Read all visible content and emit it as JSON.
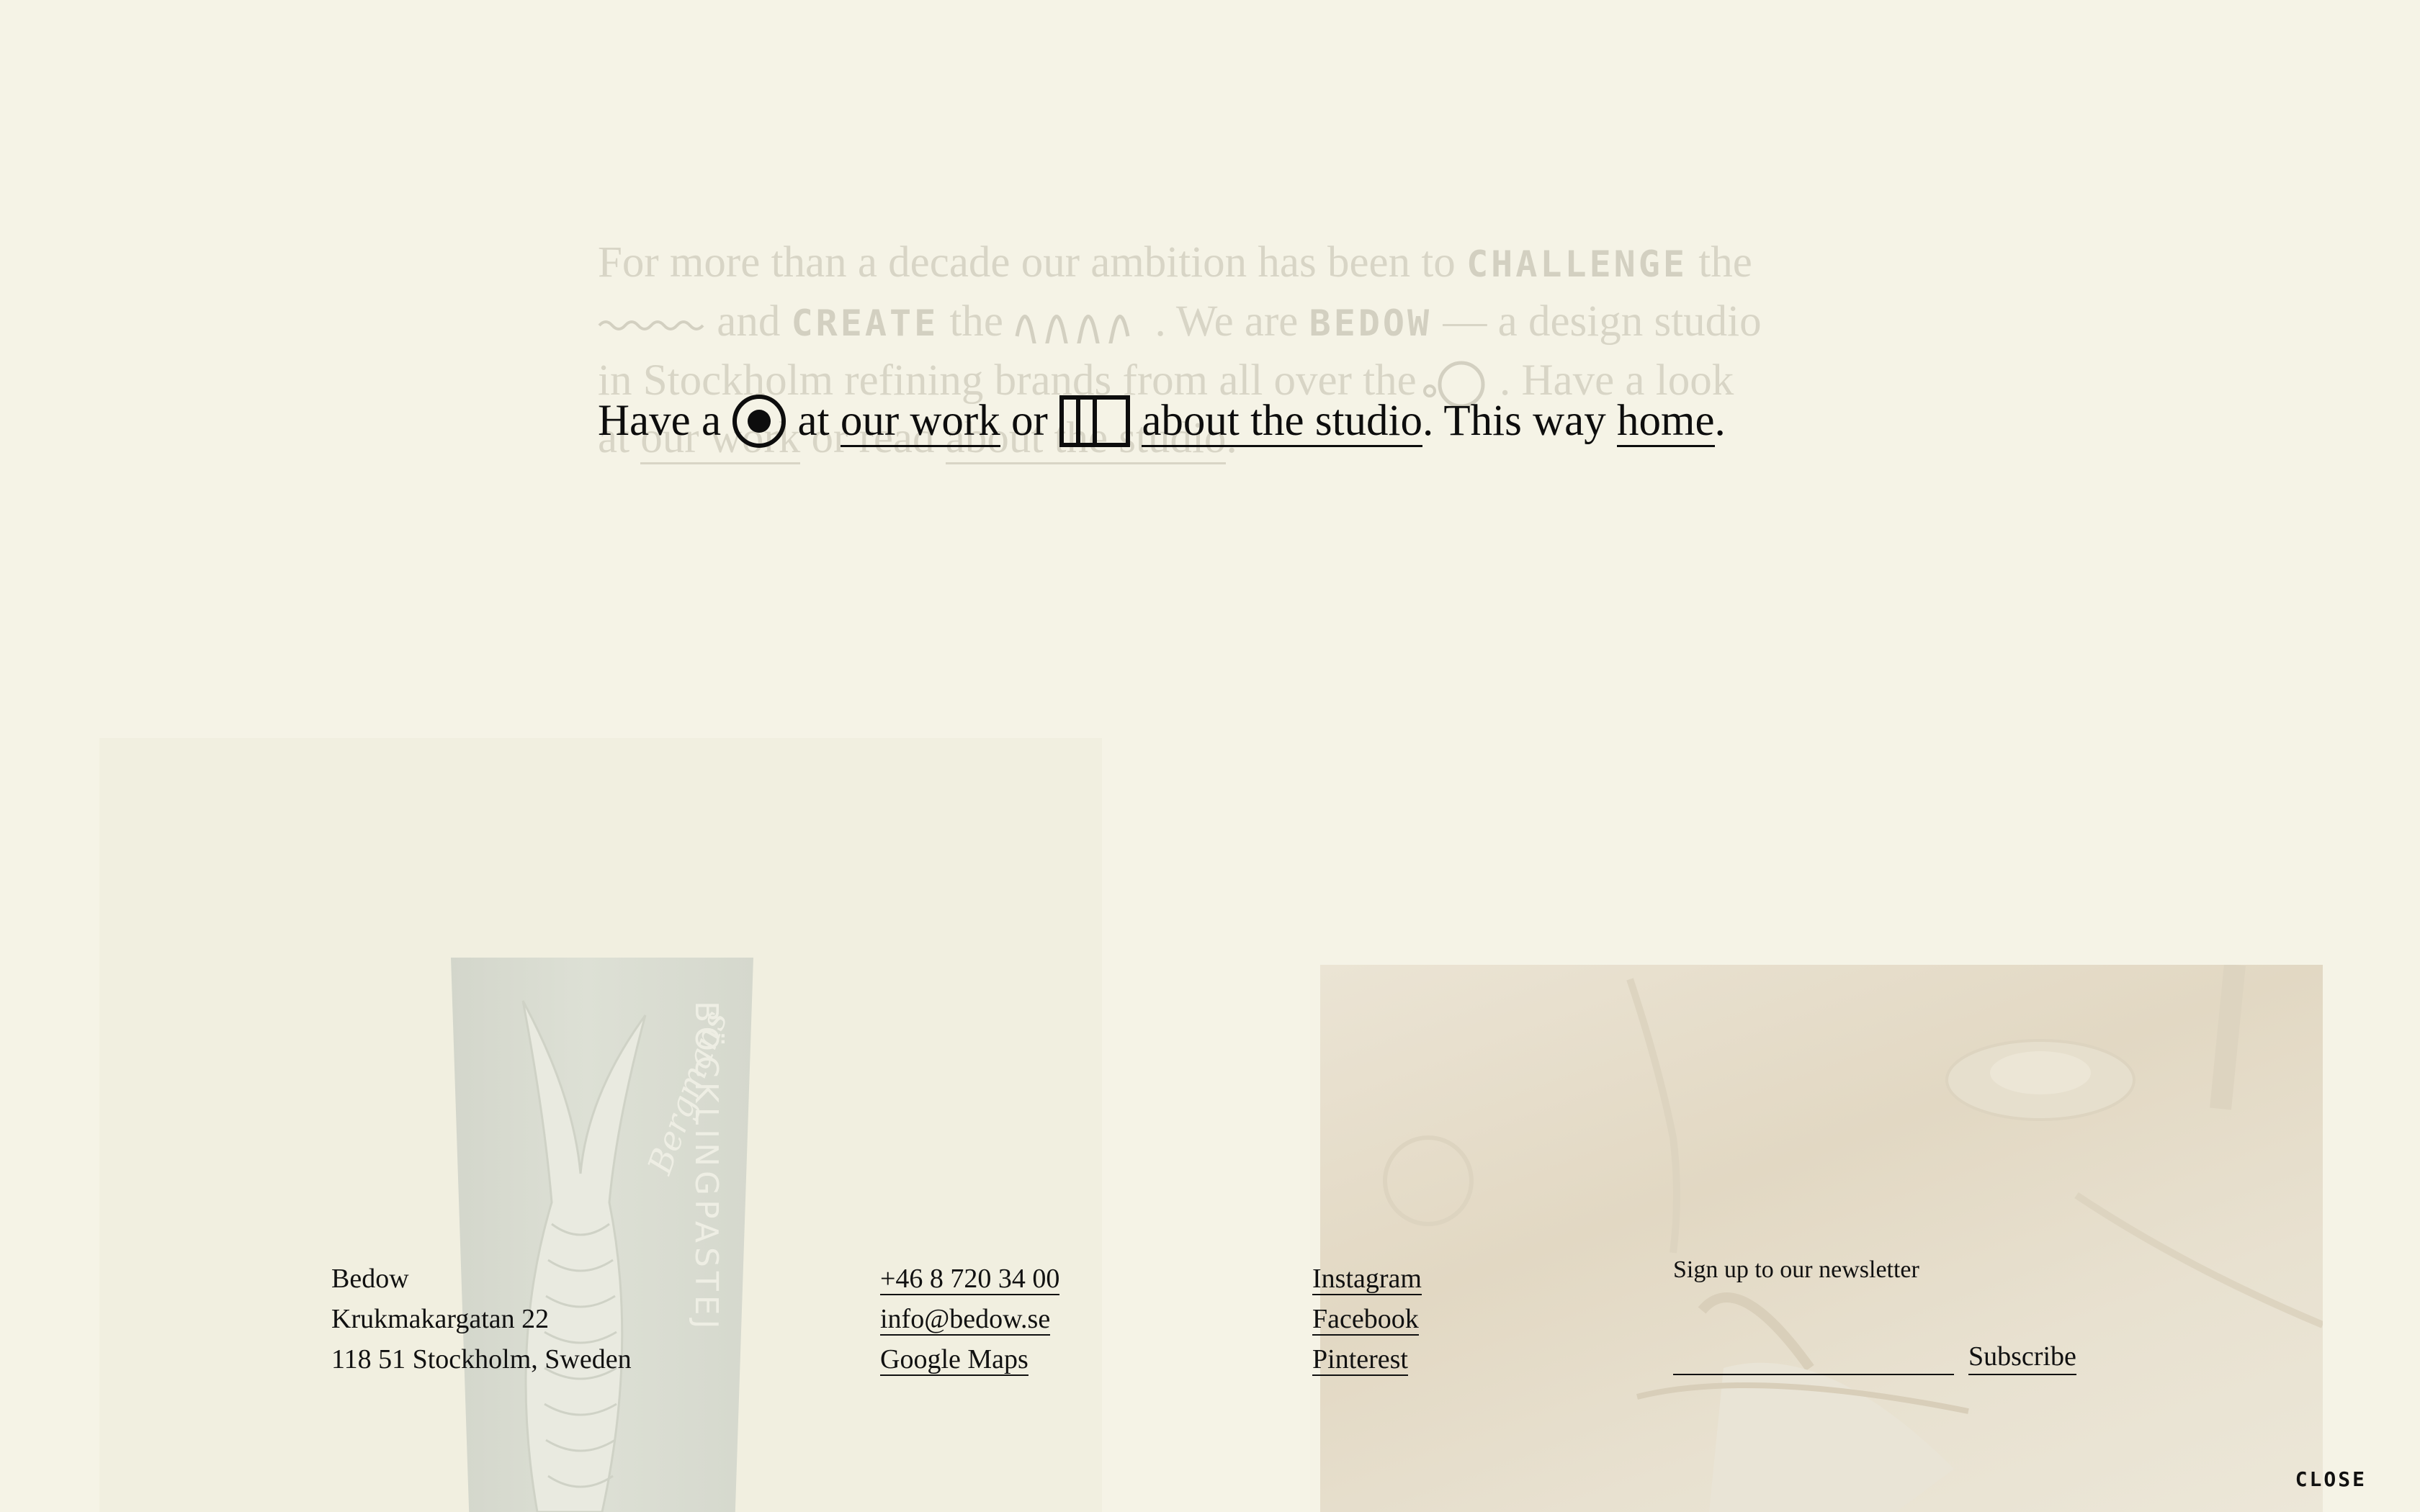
{
  "background_text": {
    "line1_a": "For more than a decade our ambition has been to",
    "line1_word": "CHALLENGE",
    "line1_b": "the",
    "line2_a": "and",
    "line2_word": "CREATE",
    "line2_b": "the",
    "line2_c": ". We are",
    "line2_brand": "BEDOW",
    "line2_d": "— a design studio",
    "line3_a": "in Stockholm refining brands from all over the",
    "line3_b": ". Have a look",
    "line4_a": "at",
    "line4_link1": "our work",
    "line4_b": "or read",
    "line4_link2": "about the studio",
    "line4_c": "."
  },
  "nav_sentence": {
    "have_a": "Have a",
    "at": "at",
    "our_work": "our work",
    "or": "or",
    "about_studio": "about the studio",
    "this_way": ". This way",
    "home": "home",
    "period": "."
  },
  "tube": {
    "label": "BÖCKLINGPASTEJ",
    "script": "Bergmans"
  },
  "footer": {
    "address": {
      "name": "Bedow",
      "street": "Krukmakargatan 22",
      "city": "118 51 Stockholm, Sweden"
    },
    "contact": {
      "phone": "+46 8 720 34 00",
      "email": "info@bedow.se",
      "maps": "Google Maps"
    },
    "social": {
      "instagram": "Instagram",
      "facebook": "Facebook",
      "pinterest": "Pinterest"
    },
    "newsletter": {
      "label": "Sign up to our newsletter",
      "input_value": "",
      "subscribe": "Subscribe"
    }
  },
  "close_label": "CLOSE",
  "colors": {
    "background": "#f5f3e6",
    "text": "#111111",
    "faded_text": "#d8d5c6"
  }
}
